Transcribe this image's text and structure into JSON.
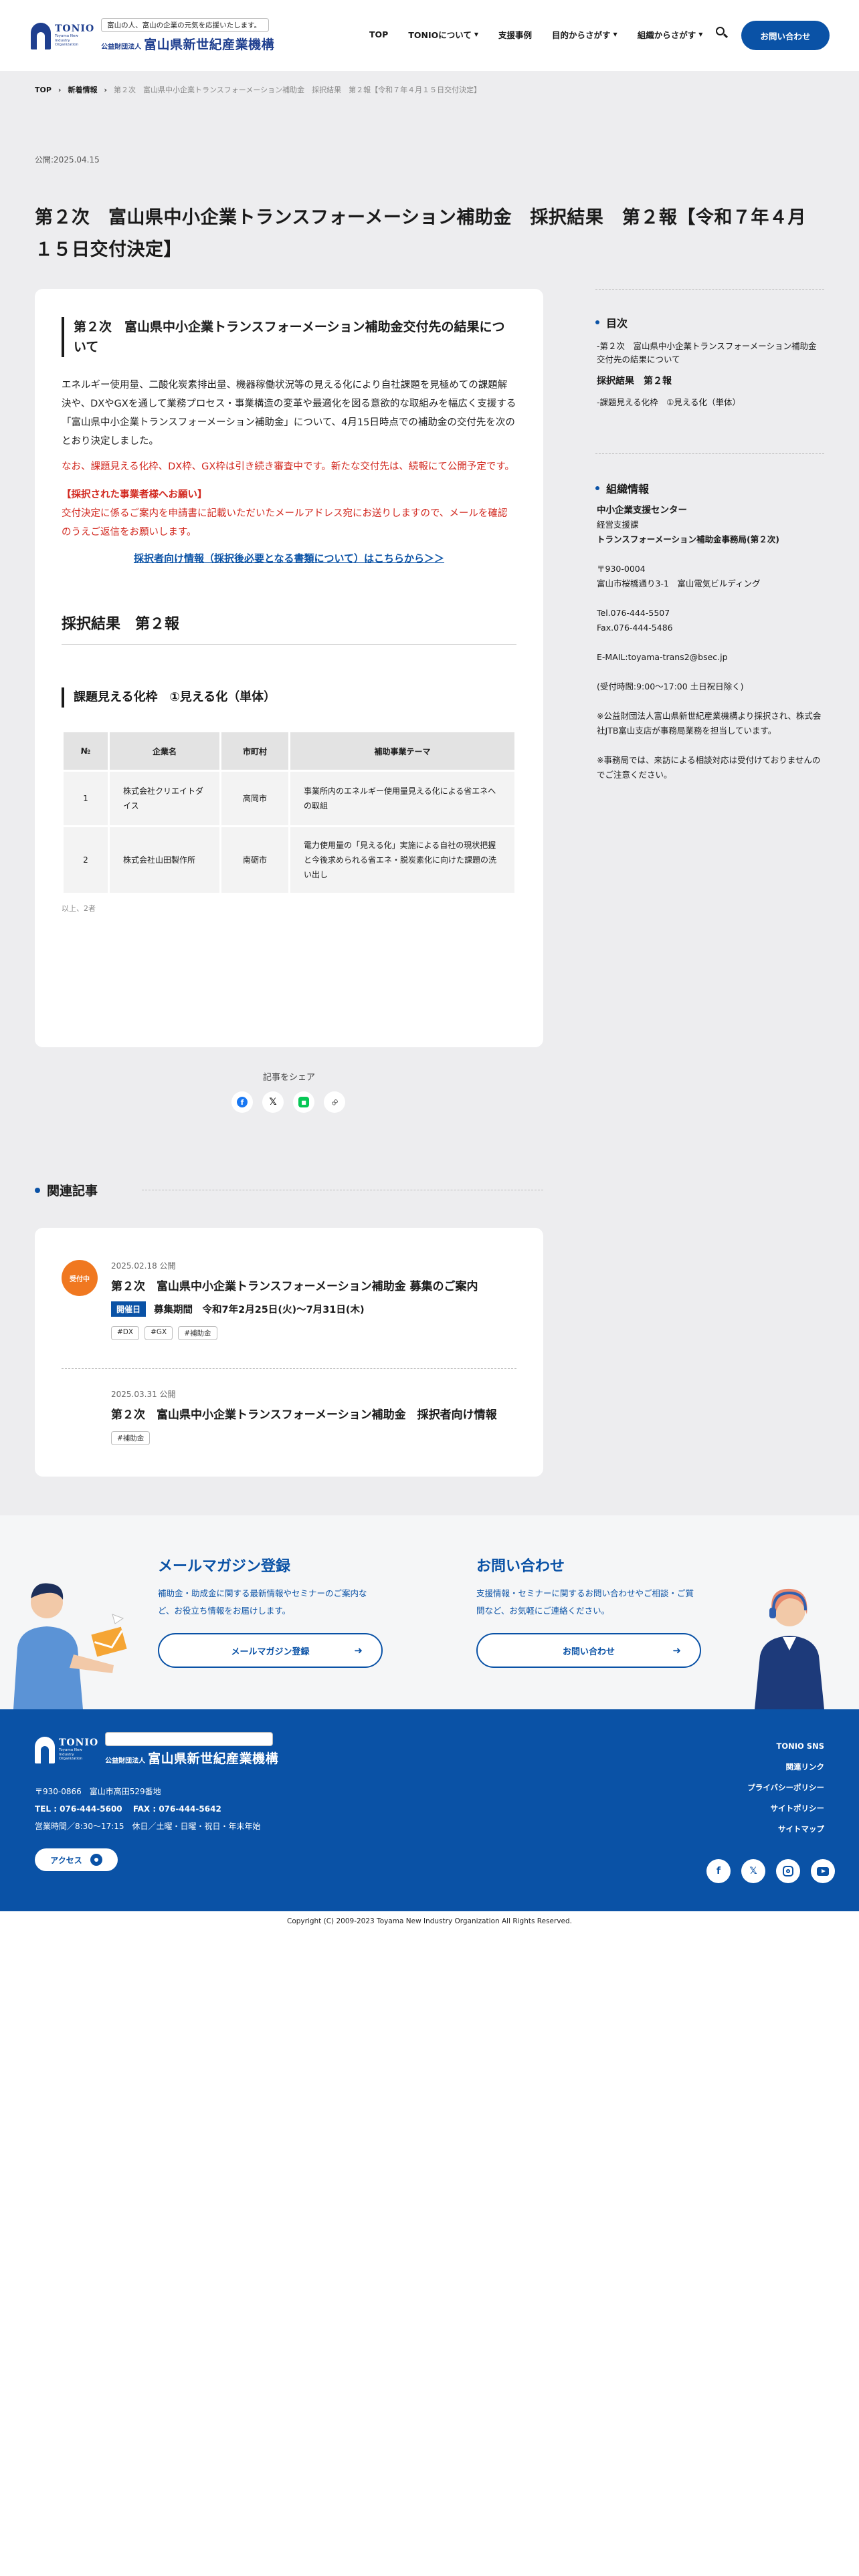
{
  "header": {
    "logo_en": "TONIO",
    "logo_en_sub": "Toyama New Industry Organization",
    "tagline": "富山の人、富山の企業の元気を応援いたします。",
    "foundation": "公益財団法人",
    "org_name": "富山県新世紀産業機構",
    "nav": [
      {
        "label": "TOP"
      },
      {
        "label": "TONIOについて"
      },
      {
        "label": "支援事例"
      },
      {
        "label": "目的からさがす"
      },
      {
        "label": "組織からさがす"
      }
    ],
    "contact_label": "お問い合わせ"
  },
  "breadcrumb": {
    "top": "TOP",
    "news": "新着情報",
    "current": "第２次　富山県中小企業トランスフォーメーション補助金　採択結果　第２報【令和７年４月１５日交付決定】"
  },
  "article": {
    "published": "公開:2025.04.15",
    "title": "第２次　富山県中小企業トランスフォーメーション補助金　採択結果　第２報【令和７年４月１５日交付決定】",
    "section_title": "第２次　富山県中小企業トランスフォーメーション補助金交付先の結果について",
    "intro": "エネルギー使用量、二酸化炭素排出量、機器稼働状況等の見える化により自社課題を見極めての課題解決や、DXやGXを通して業務プロセス・事業構造の変革や最適化を図る意欲的な取組みを幅広く支援する「富山県中小企業トランスフォーメーション補助金」について、4月15日時点での補助金の交付先を次のとおり決定しました。",
    "red_note": "なお、課題見える化枠、DX枠、GX枠は引き続き審査中です。新たな交付先は、続報にて公開予定です。",
    "red_heading": "【採択された事業者様へお願い】",
    "red_body": "交付決定に係るご案内を申請書に記載いただいたメールアドレス宛にお送りしますので、メールを確認のうえご返信をお願いします。",
    "blue_link": "採択者向け情報（採択後必要となる書類について）はこちらから＞＞",
    "result_heading": "採択結果　第２報",
    "category_heading": "課題見える化枠　①見える化（単体）",
    "table": {
      "headers": [
        "№",
        "企業名",
        "市町村",
        "補助事業テーマ"
      ],
      "rows": [
        [
          "1",
          "株式会社クリエイトダイス",
          "高岡市",
          "事業所内のエネルギー使用量見える化による省エネへの取組"
        ],
        [
          "2",
          "株式会社山田製作所",
          "南砺市",
          "電力使用量の「見える化」実施による自社の現状把握と今後求められる省エネ・脱炭素化に向けた課題の洗い出し"
        ]
      ]
    },
    "count": "以上、2者",
    "share_label": "記事をシェア"
  },
  "sidebar": {
    "toc_title": "目次",
    "toc": [
      "-第２次　富山県中小企業トランスフォーメーション補助金交付先の結果について",
      "採択結果　第２報",
      "-課題見える化枠　①見える化（単体）"
    ],
    "org_title": "組織情報",
    "org_name": "中小企業支援センター",
    "dept1": "経営支援課",
    "dept2": "トランスフォーメーション補助金事務局(第２次)",
    "zip": "〒930-0004",
    "address": "富山市桜橋通り3-1　富山電気ビルディング",
    "tel": "Tel.076-444-5507",
    "fax": "Fax.076-444-5486",
    "email": "E-MAIL:toyama-trans2@bsec.jp",
    "hours": "(受付時間:9:00～17:00 土日祝日除く)",
    "note1": "※公益財団法人富山県新世紀産業機構より採択され、株式会社JTB富山支店が事務局業務を担当しています。",
    "note2": "※事務局では、来訪による相談対応は受付けておりませんのでご注意ください。"
  },
  "related": {
    "heading": "関連記事",
    "items": [
      {
        "badge": "受付中",
        "date": "2025.02.18 公開",
        "title": "第２次　富山県中小企業トランスフォーメーション補助金 募集のご案内",
        "open_tag": "開催日",
        "period": "募集期間　令和7年2月25日(火)〜7月31日(木)",
        "tags": [
          "#DX",
          "#GX",
          "#補助金"
        ]
      },
      {
        "date": "2025.03.31 公開",
        "title": "第２次　富山県中小企業トランスフォーメーション補助金　採択者向け情報",
        "tags": [
          "#補助金"
        ]
      }
    ]
  },
  "cta": {
    "mail_title": "メールマガジン登録",
    "mail_text": "補助金・助成金に関する最新情報やセミナーのご案内など、お役立ち情報をお届けします。",
    "mail_btn": "メールマガジン登録",
    "contact_title": "お問い合わせ",
    "contact_text": "支援情報・セミナーに関するお問い合わせやご相談・ご質問など、お気軽にご連絡ください。",
    "contact_btn": "お問い合わせ"
  },
  "footer": {
    "zip_addr": "〒930-0866　富山市高田529番地",
    "tel_fax": "TEL : 076-444-5600　 FAX : 076-444-5642",
    "hours": "営業時間／8:30〜17:15　休日／土曜・日曜・祝日・年末年始",
    "access": "アクセス",
    "links": [
      "TONIO SNS",
      "関連リンク",
      "プライバシーポリシー",
      "サイトポリシー",
      "サイトマップ"
    ],
    "copyright": "Copyright (C) 2009-2023 Toyama New Industry Organization All Rights Reserved."
  },
  "colors": {
    "brand_blue": "#0a52a6",
    "accent_red": "#d2281f",
    "badge_orange": "#f07820"
  }
}
